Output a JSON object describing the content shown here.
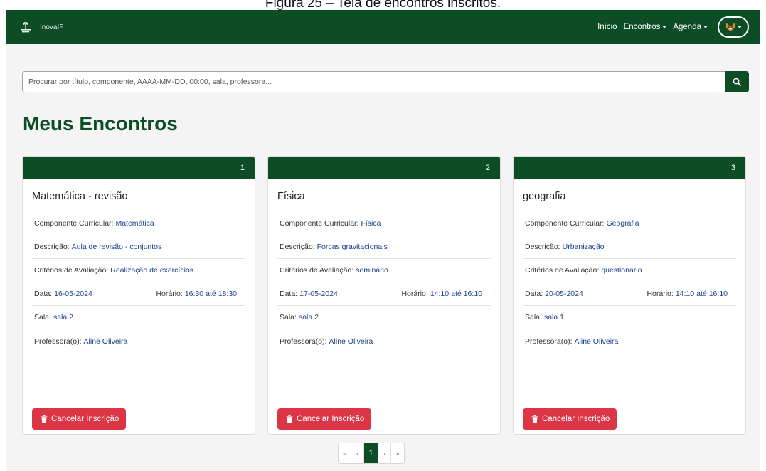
{
  "caption": "Figura 25 – Tela de encontros inscritos.",
  "nav": {
    "brand": "InovaIF",
    "links": [
      {
        "label": "Início",
        "dropdown": false
      },
      {
        "label": "Encontros",
        "dropdown": true
      },
      {
        "label": "Agenda",
        "dropdown": true
      }
    ]
  },
  "search": {
    "placeholder": "Procurar por título, componente, AAAA-MM-DD, 00:00, sala, professora..."
  },
  "page_title": "Meus Encontros",
  "labels": {
    "componente": "Componente Curricular:",
    "descricao": "Descrição:",
    "criterios": "Critérios de Avaliação:",
    "data": "Data:",
    "horario": "Horário:",
    "ate": "até",
    "sala": "Sala:",
    "professora": "Professora(o):",
    "cancel": "Cancelar Inscrição"
  },
  "cards": [
    {
      "number": "1",
      "title": "Matemática - revisão",
      "componente": "Matemática",
      "descricao": "Aula de revisão - conjuntos",
      "criterios": "Realização de exercícios",
      "data": "16-05-2024",
      "inicio": "16:30",
      "fim": "18:30",
      "sala": "sala 2",
      "professora": "Aline Oliveira"
    },
    {
      "number": "2",
      "title": "Física",
      "componente": "Física",
      "descricao": "Forcas gravitacionais",
      "criterios": "seminário",
      "data": "17-05-2024",
      "inicio": "14:10",
      "fim": "16:10",
      "sala": "sala 2",
      "professora": "Aline Oliveira"
    },
    {
      "number": "3",
      "title": "geografia",
      "componente": "Geografia",
      "descricao": "Urbanização",
      "criterios": "questionário",
      "data": "20-05-2024",
      "inicio": "14:10",
      "fim": "16:10",
      "sala": "sala 1",
      "professora": "Aline Oliveira"
    }
  ],
  "pagination": {
    "first": "«",
    "prev": "‹",
    "current": "1",
    "next": "›",
    "last": "»"
  },
  "colors": {
    "primary": "#0d4d26",
    "danger": "#dc3545",
    "link": "#1a3f8a"
  }
}
